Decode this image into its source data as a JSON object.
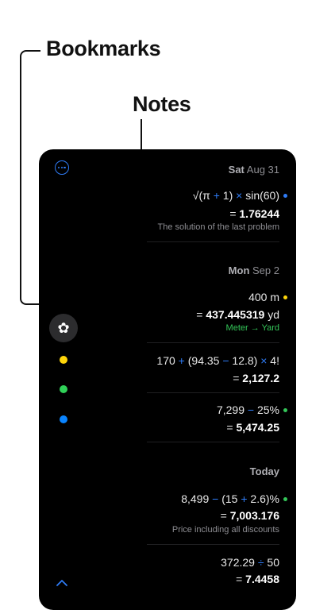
{
  "callouts": {
    "bookmarks": "Bookmarks",
    "notes": "Notes"
  },
  "sidebar": {
    "bookmark_colors": [
      "#ffd60a",
      "#30d158",
      "#0a84ff"
    ]
  },
  "groups": [
    {
      "date_day": "Sat",
      "date_rest": "Aug 31"
    },
    {
      "date_day": "Mon",
      "date_rest": "Sep 2"
    },
    {
      "date_day": "Today",
      "date_rest": ""
    }
  ],
  "entries": {
    "e1": {
      "expr": [
        "√(π ",
        "+",
        " 1) ",
        "×",
        " sin(60)"
      ],
      "result_prefix": "= ",
      "result": "1.76244",
      "note": "The solution of the last problem"
    },
    "e2": {
      "expr": "400 m",
      "result_prefix": "= ",
      "result": "437.445319",
      "unit": " yd",
      "conversion": "Meter → Yard"
    },
    "e3": {
      "expr": [
        "170 ",
        "+",
        " (94.35 ",
        "−",
        " 12.8) ",
        "×",
        " 4!"
      ],
      "result_prefix": "= ",
      "result": "2,127.2"
    },
    "e4": {
      "expr": [
        "7,299 ",
        "−",
        " 25%"
      ],
      "result_prefix": "= ",
      "result": "5,474.25"
    },
    "e5": {
      "expr": [
        "8,499 ",
        "−",
        " (15 ",
        "+",
        " 2.6)%"
      ],
      "result_prefix": "= ",
      "result": "7,003.176",
      "note": "Price including all discounts"
    },
    "e6": {
      "expr": [
        "372.29 ",
        "÷",
        " 50"
      ],
      "result_prefix": "= ",
      "result": "7.4458"
    }
  },
  "colors": {
    "accent": "#2f7cf6",
    "marker_blue": "#2f7cf6",
    "marker_yellow": "#ffd60a",
    "marker_green": "#34c759"
  }
}
